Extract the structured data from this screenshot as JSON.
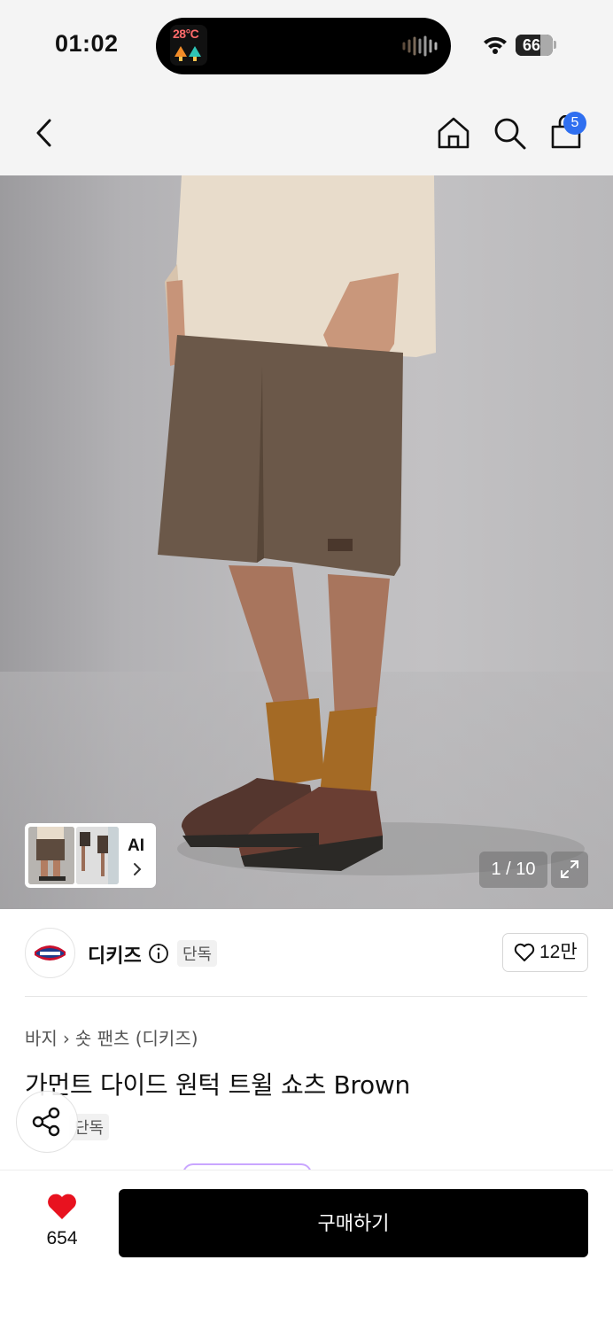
{
  "status_bar": {
    "time": "01:02",
    "island_app_text": "28°C",
    "battery": "66",
    "battery_level_pct": 66
  },
  "header": {
    "cart_count": "5",
    "icons": [
      "back-icon",
      "home-icon",
      "search-icon",
      "cart-icon"
    ]
  },
  "gallery": {
    "ai_label": "AI",
    "counter": "1 / 10"
  },
  "brand": {
    "name": "디키즈",
    "tag": "단독",
    "like_count": "12만"
  },
  "product": {
    "breadcrumb": [
      "바지",
      "숏 팬츠 (디키즈)"
    ],
    "title": "가먼트 다이드 원턱 트윌 쇼츠 Brown",
    "tag": "단독"
  },
  "bottom": {
    "like_count": "654",
    "buy_label": "구매하기"
  },
  "colors": {
    "accent": "#2f6ff0",
    "heart": "#e8121f",
    "buy_button": "#000000"
  }
}
